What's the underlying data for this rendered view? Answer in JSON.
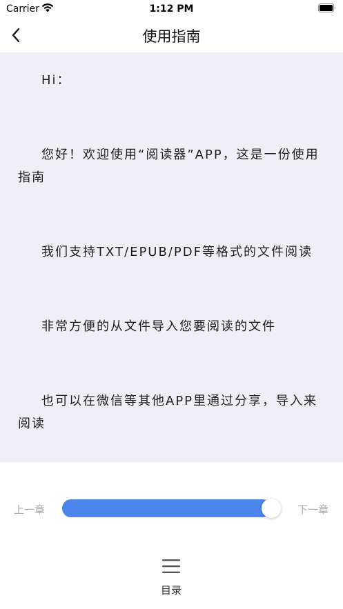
{
  "status_bar": {
    "carrier": "Carrier",
    "time": "1:12 PM",
    "wifi_icon": "wifi-icon",
    "battery_icon": "battery-icon"
  },
  "nav": {
    "back_icon": "chevron-left-icon",
    "title": "使用指南"
  },
  "content": {
    "background": "#f0eff5",
    "paragraphs": [
      "Hi：",
      "您好！欢迎使用“阅读器”APP，这是一份使用指南",
      "我们支持TXT/EPUB/PDF等格式的文件阅读",
      "非常方便的从文件导入您要阅读的文件",
      "也可以在微信等其他APP里通过分享，导入来阅读"
    ]
  },
  "progress": {
    "prev_label": "上一章",
    "next_label": "下一章",
    "value": 0.96,
    "accent": "#4d86ea"
  },
  "toolbar": {
    "toc_label": "目录",
    "toc_icon": "menu-icon"
  }
}
